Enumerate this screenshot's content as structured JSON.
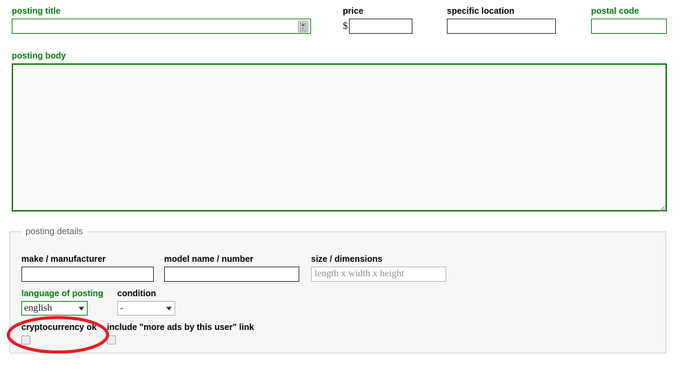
{
  "colors": {
    "green": "#0a7a12",
    "black": "#000000",
    "annotation_red": "#e01f26",
    "fieldset_bg": "#f6f6f6",
    "textarea_bg": "#fafafa"
  },
  "form": {
    "title_field": {
      "label": "posting title",
      "value": "",
      "placeholder": "",
      "icon": "autofill-icon"
    },
    "price_field": {
      "label": "price",
      "currency_symbol": "$",
      "value": "",
      "placeholder": ""
    },
    "location_field": {
      "label": "specific location",
      "value": "",
      "placeholder": ""
    },
    "postal_field": {
      "label": "postal code",
      "value": "",
      "placeholder": ""
    },
    "body_field": {
      "label": "posting body",
      "value": "",
      "placeholder": ""
    }
  },
  "details": {
    "legend": "posting details",
    "make_field": {
      "label": "make / manufacturer",
      "value": "",
      "placeholder": ""
    },
    "model_field": {
      "label": "model name / number",
      "value": "",
      "placeholder": ""
    },
    "size_field": {
      "label": "size / dimensions",
      "value": "",
      "placeholder": "length x width x height"
    },
    "language_select": {
      "label": "language of posting",
      "selected": "english"
    },
    "condition_select": {
      "label": "condition",
      "selected": "-"
    },
    "crypto_checkbox": {
      "label": "cryptocurrency ok",
      "checked": false
    },
    "more_ads_checkbox": {
      "label": "include \"more ads by this user\" link",
      "checked": false
    }
  },
  "annotation": {
    "shape": "ellipse",
    "target": "cryptocurrency ok"
  }
}
